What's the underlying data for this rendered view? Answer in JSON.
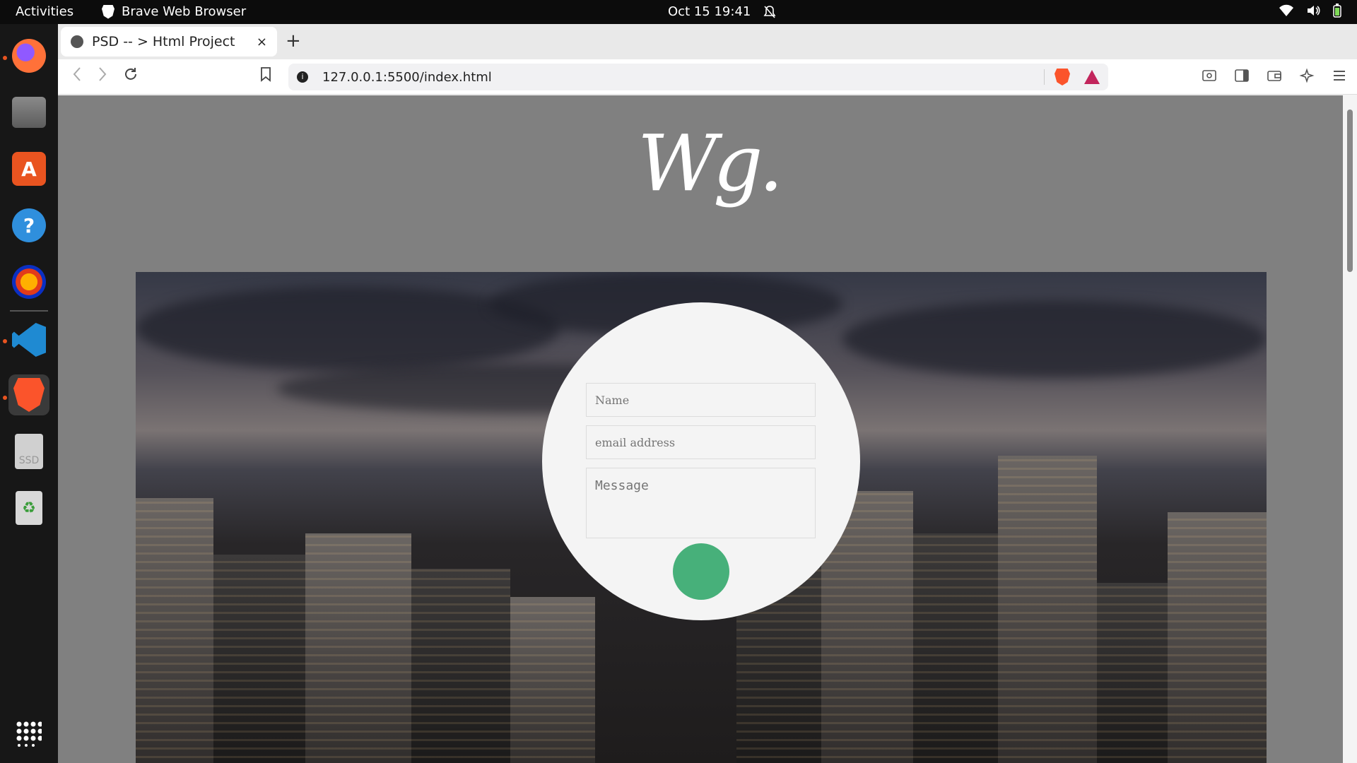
{
  "topbar": {
    "activities": "Activities",
    "app_name": "Brave Web Browser",
    "clock": "Oct 15  19:41"
  },
  "dock": {
    "items": [
      "Firefox",
      "Files",
      "Ubuntu Software",
      "Help",
      "Audacity",
      "Visual Studio Code",
      "Brave",
      "SSD",
      "Trash",
      "Show Applications"
    ],
    "ssd_label": "SSD"
  },
  "browser": {
    "tab_title": "PSD -- > Html Project",
    "tab_close": "×",
    "new_tab": "+",
    "url": "127.0.0.1:5500/index.html"
  },
  "page": {
    "logo_text": "Wg.",
    "form": {
      "name_placeholder": "Name",
      "email_placeholder": "email address",
      "message_placeholder": "Message"
    },
    "colors": {
      "background": "#808080",
      "card": "#f4f4f4",
      "submit": "#47b07a"
    }
  }
}
